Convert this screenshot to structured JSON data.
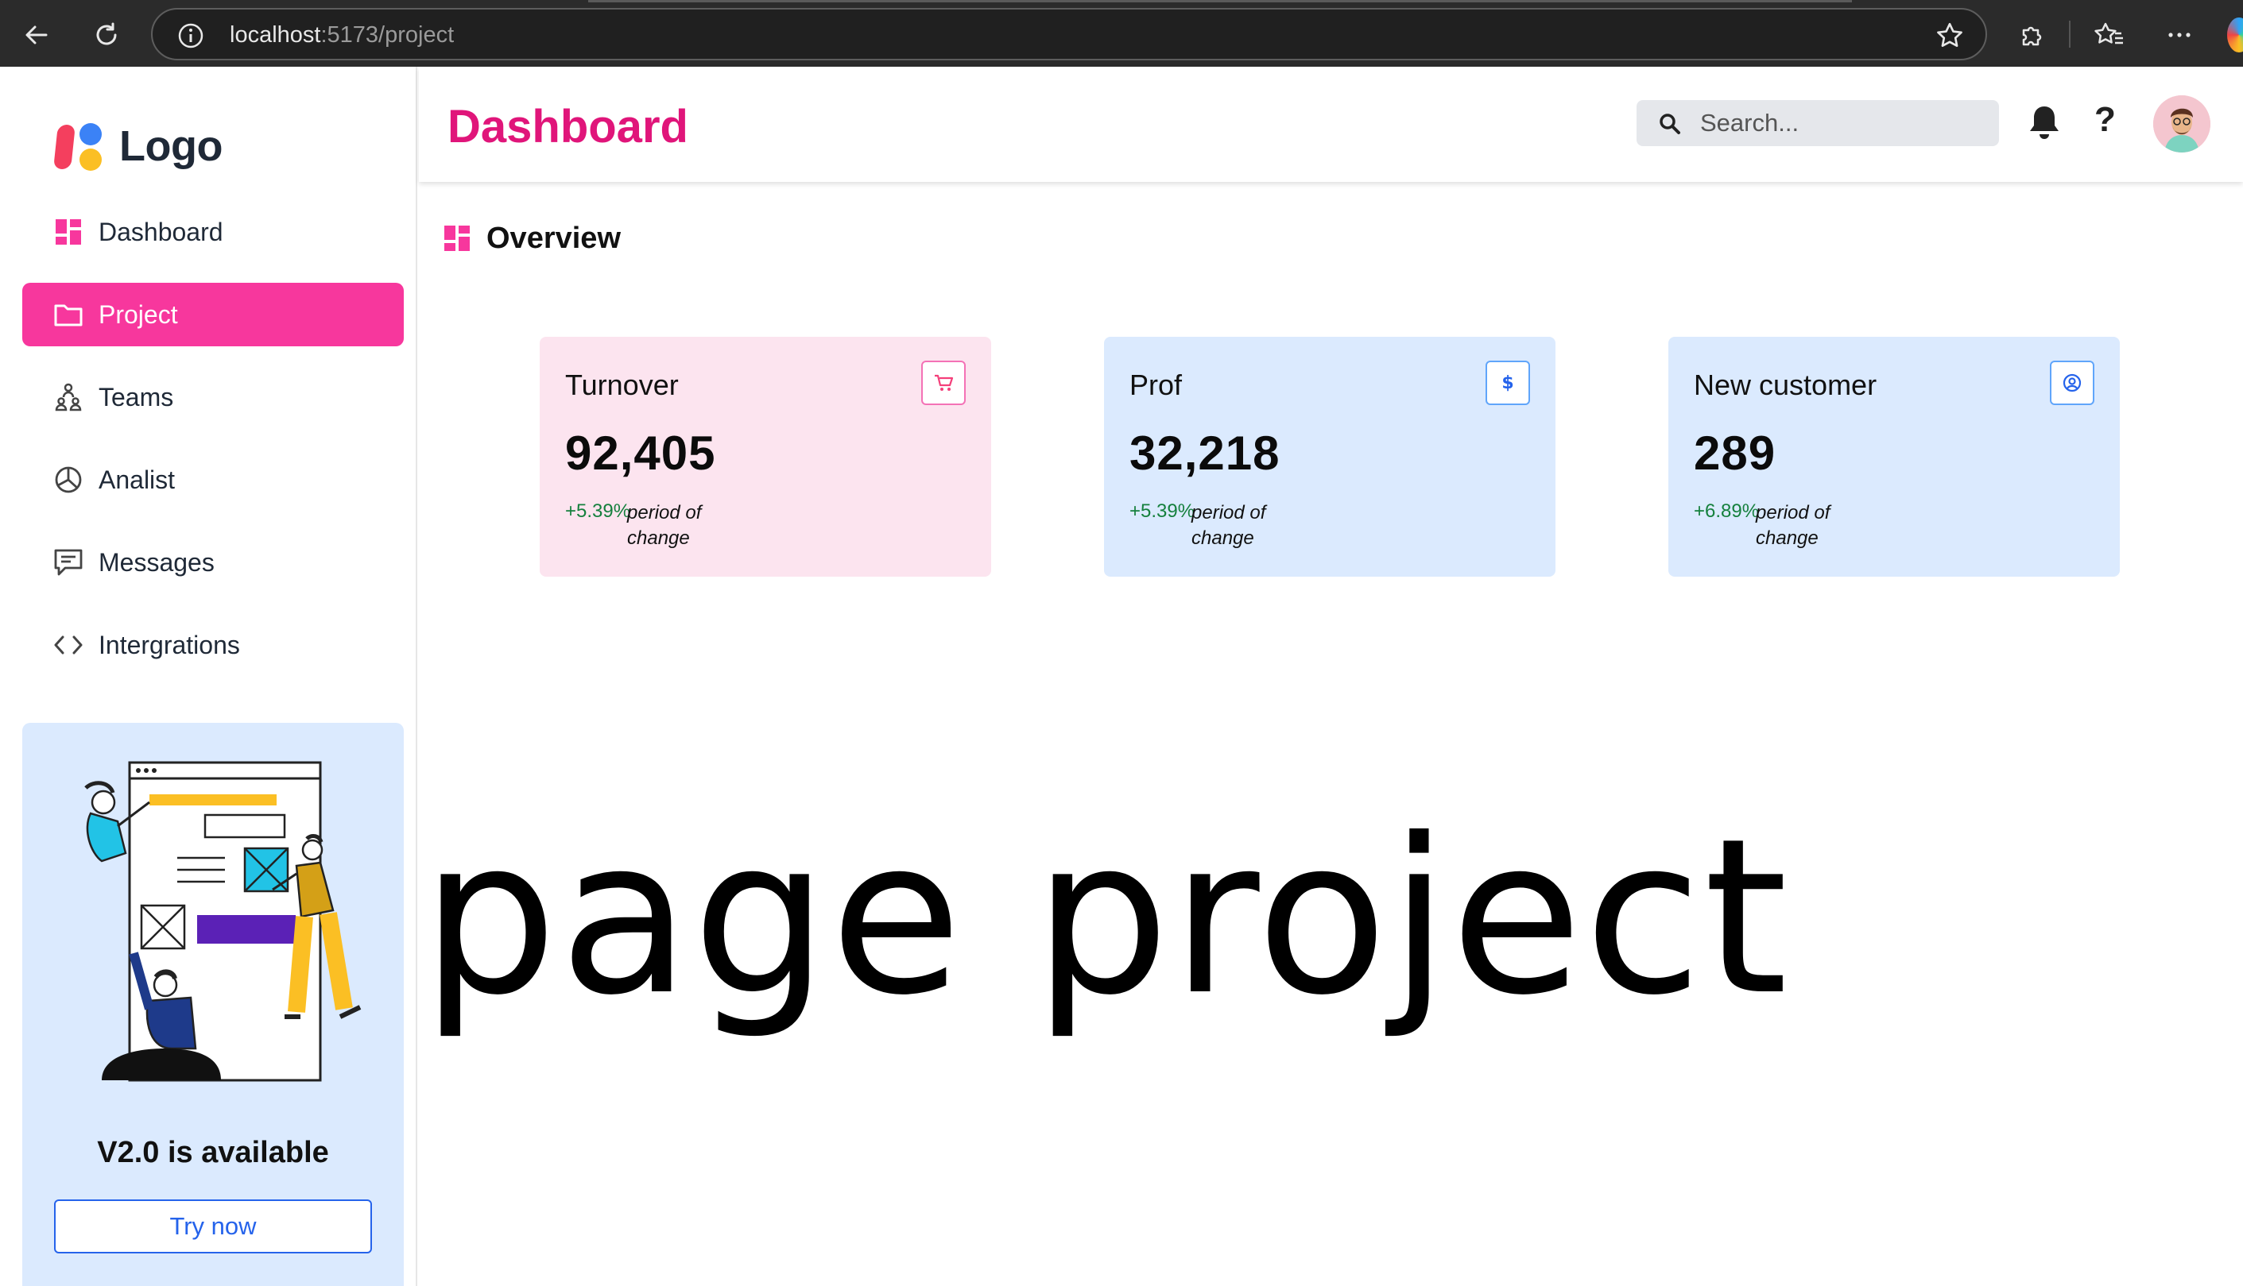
{
  "browser": {
    "url_host": "localhost",
    "url_path": ":5173/project"
  },
  "sidebar": {
    "logo_text": "Logo",
    "items": [
      {
        "label": "Dashboard",
        "icon": "dashboard-icon",
        "active": false
      },
      {
        "label": "Project",
        "icon": "folder-icon",
        "active": true
      },
      {
        "label": "Teams",
        "icon": "teams-icon",
        "active": false
      },
      {
        "label": "Analist",
        "icon": "pie-chart-icon",
        "active": false
      },
      {
        "label": "Messages",
        "icon": "message-icon",
        "active": false
      },
      {
        "label": "Intergrations",
        "icon": "code-icon",
        "active": false
      }
    ],
    "promo": {
      "title": "V2.0 is available",
      "button_label": "Try now"
    }
  },
  "header": {
    "title": "Dashboard",
    "search_placeholder": "Search...",
    "help_label": "?"
  },
  "main": {
    "section_title": "Overview",
    "cards": [
      {
        "title": "Turnover",
        "value": "92,405",
        "change": "+5.39%",
        "note": "period of change",
        "icon": "cart-icon",
        "color": "#fce4ef"
      },
      {
        "title": "Prof",
        "value": "32,218",
        "change": "+5.39%",
        "note": "period of change",
        "icon": "dollar-icon",
        "color": "#dbeafe"
      },
      {
        "title": "New customer",
        "value": "289",
        "change": "+6.89%",
        "note": "period of change",
        "icon": "user-circle-icon",
        "color": "#dbeafe"
      }
    ],
    "big_text": "page project"
  },
  "colors": {
    "accent": "#f7379d",
    "title": "#e0157a",
    "positive": "#15803d",
    "promo_bg": "#dbeafe"
  }
}
